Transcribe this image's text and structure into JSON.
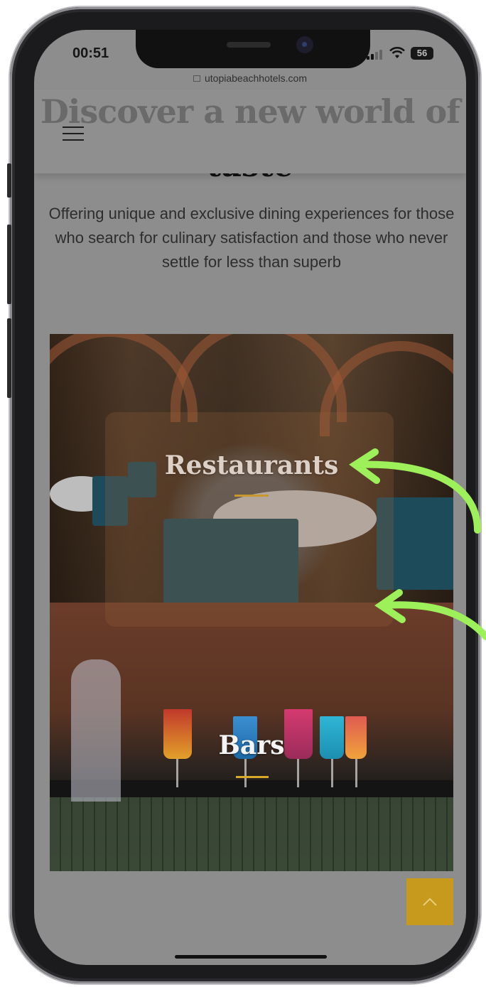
{
  "status_bar": {
    "time": "00:51",
    "battery": "56"
  },
  "browser": {
    "url": "utopiabeachhotels.com"
  },
  "page": {
    "heading_line1": "Discover a new world of",
    "heading_line2": "taste",
    "tagline": "Offering unique and exclusive dining experiences for those who search for culinary satisfaction and those who never settle for less than superb"
  },
  "cards": [
    {
      "label": "Restaurants"
    },
    {
      "label": "Bars"
    }
  ],
  "colors": {
    "accent": "#d9a82a",
    "scroll_top_button": "#c79a1e",
    "arrow": "#9ef05a"
  },
  "icons": {
    "menu": "hamburger-menu-icon",
    "scroll_top": "chevron-up-icon"
  }
}
